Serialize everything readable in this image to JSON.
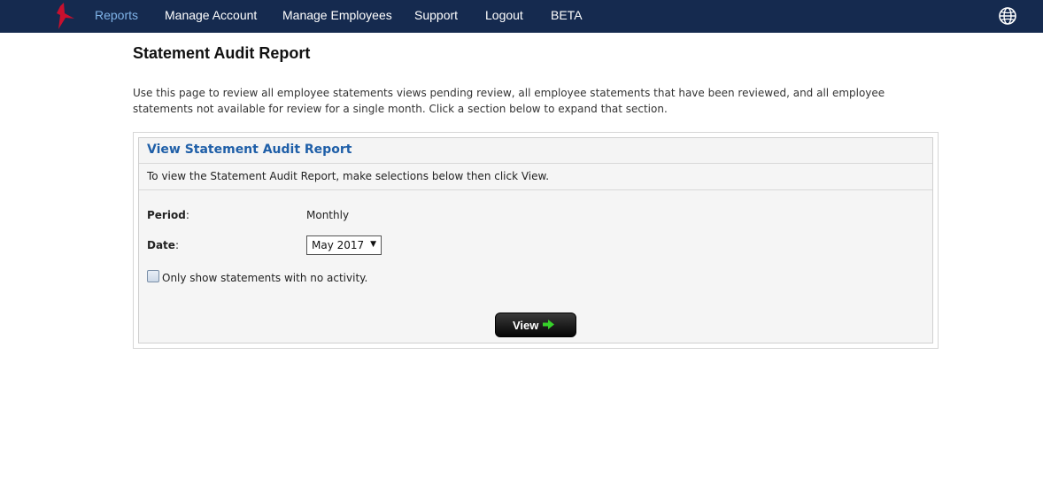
{
  "nav": {
    "items": [
      {
        "label": "Reports",
        "active": true
      },
      {
        "label": "Manage Account"
      },
      {
        "label": "Manage Employees"
      },
      {
        "label": "Support"
      },
      {
        "label": "Logout"
      },
      {
        "label": "BETA"
      }
    ],
    "logo_icon": "brand-logo-icon",
    "globe_icon": "globe-icon"
  },
  "page": {
    "title": "Statement Audit Report",
    "intro": "Use this page to review all employee statements views pending review, all employee statements that have been reviewed, and all employee statements not available for review for a single month. Click a section below to expand that section."
  },
  "panel": {
    "title": "View Statement Audit Report",
    "instructions": "To view the Statement Audit Report, make selections below then click View.",
    "period_label": "Period",
    "period_value": "Monthly",
    "date_label": "Date",
    "date_selected": "May 2017",
    "checkbox_label": "Only show statements with no activity.",
    "checkbox_checked": false,
    "view_button": "View"
  },
  "colors": {
    "nav_bg": "#152a4f",
    "nav_active": "#7fb3e8",
    "panel_title": "#1f5fa8",
    "accent_arrow": "#37d12a",
    "logo_red": "#c8102e"
  }
}
